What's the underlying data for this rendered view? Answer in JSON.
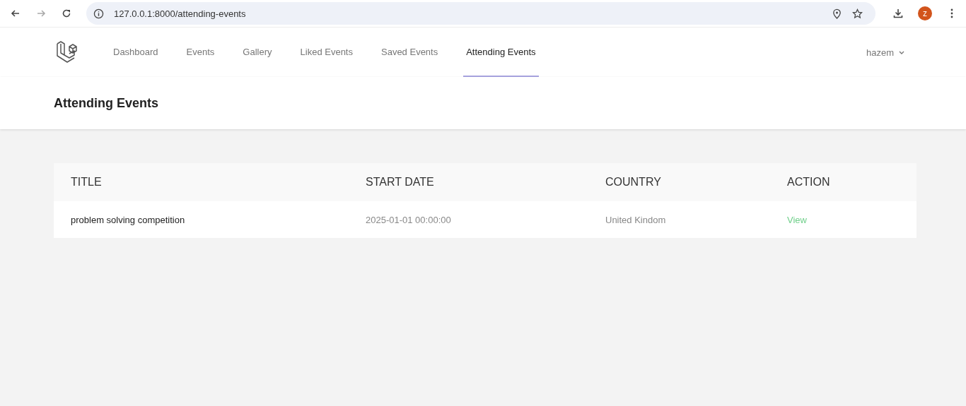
{
  "browser": {
    "url": "127.0.0.1:8000/attending-events",
    "profile_initial": "z"
  },
  "nav": {
    "items": [
      {
        "label": "Dashboard",
        "selected": false
      },
      {
        "label": "Events",
        "selected": false
      },
      {
        "label": "Gallery",
        "selected": false
      },
      {
        "label": "Liked Events",
        "selected": false
      },
      {
        "label": "Saved Events",
        "selected": false
      },
      {
        "label": "Attending Events",
        "selected": true
      }
    ],
    "user": "hazem"
  },
  "page_title": "Attending Events",
  "table": {
    "columns": [
      "TITLE",
      "START DATE",
      "COUNTRY",
      "ACTION"
    ],
    "rows": [
      {
        "title": "problem solving competition",
        "start_date": "2025-01-01 00:00:00",
        "country": "United Kindom",
        "action": "View"
      }
    ]
  }
}
